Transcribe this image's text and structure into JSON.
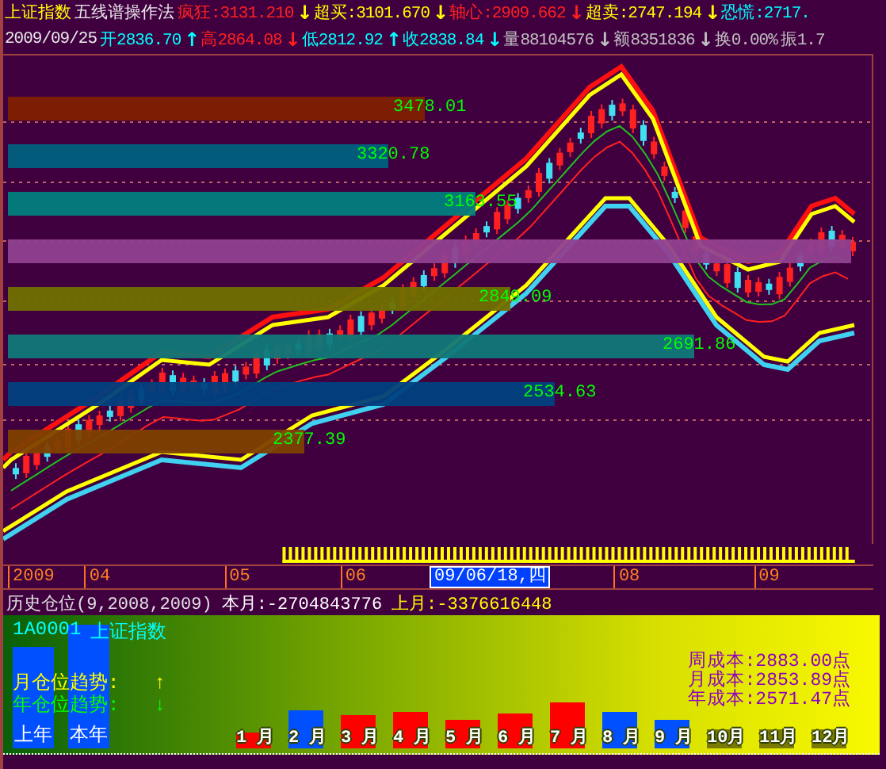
{
  "quote_lines": [
    [
      {
        "text": "上证指数",
        "color": "#ffff00"
      },
      {
        "text": "五线谱操作法",
        "color": "#e8e8e8"
      },
      {
        "text": "疯狂:3131.210",
        "color": "#ff2020",
        "arrow": {
          "text": "↓",
          "color": "#ffff00"
        }
      },
      {
        "text": "超买:3101.670",
        "color": "#ffff00",
        "arrow": {
          "text": "↓",
          "color": "#ffff00"
        }
      },
      {
        "text": "轴心:2909.662",
        "color": "#ff2020",
        "arrow": {
          "text": "↓",
          "color": "#ff2020"
        }
      },
      {
        "text": "超卖:2747.194",
        "color": "#ffff00",
        "arrow": {
          "text": "↓",
          "color": "#ffff00"
        }
      },
      {
        "text": "恐慌:2717.",
        "color": "#00ffff"
      }
    ],
    [
      {
        "text": "2009/09/25",
        "color": "#e8e8e8"
      },
      {
        "text": "开2836.70",
        "color": "#00ffff",
        "arrow": {
          "text": "↑",
          "color": "#00ffff"
        }
      },
      {
        "text": "高2864.08",
        "color": "#ff2020",
        "arrow": {
          "text": "↓",
          "color": "#ff2020"
        }
      },
      {
        "text": "低2812.92",
        "color": "#00ffff",
        "arrow": {
          "text": "↑",
          "color": "#00ffff"
        }
      },
      {
        "text": "收2838.84",
        "color": "#00ffff",
        "arrow": {
          "text": "↓",
          "color": "#00ffff"
        }
      },
      {
        "text": "量88104576",
        "color": "#c0c0c0",
        "arrow": {
          "text": "↓",
          "color": "#c0c0c0"
        }
      },
      {
        "text": "额8351836",
        "color": "#c0c0c0",
        "arrow": {
          "text": "↓",
          "color": "#c0c0c0"
        }
      },
      {
        "text": "换0.00%",
        "color": "#c0c0c0"
      },
      {
        "text": "振1.7",
        "color": "#c0c0c0"
      }
    ]
  ],
  "price_bands": [
    {
      "label": "3478.01",
      "color": "#802000"
    },
    {
      "label": "3320.78",
      "color": "#006080"
    },
    {
      "label": "3163.55",
      "color": "#008080"
    },
    {
      "color": "#904090"
    },
    {
      "label": "2849.09",
      "color": "#707000"
    },
    {
      "label": "2691.86",
      "color": "#107878"
    },
    {
      "label": "2534.63",
      "color": "#004080"
    },
    {
      "label": "2377.39",
      "color": "#804000"
    }
  ],
  "time_axis": [
    {
      "label": "2009",
      "selected": false
    },
    {
      "label": "04",
      "selected": false
    },
    {
      "label": "05",
      "selected": false
    },
    {
      "label": "06",
      "selected": false
    },
    {
      "label": "09/06/18,四",
      "selected": true
    },
    {
      "label": "08",
      "selected": false
    },
    {
      "label": "09",
      "selected": false
    }
  ],
  "info_line": {
    "title": "历史仓位(9,2008,2009)",
    "this_month": "本月:-2704843776",
    "last_month": "上月:-3376616448"
  },
  "position_panel": {
    "code": "1A0001",
    "name": "上证指数",
    "year_bars": [
      {
        "label": "上年"
      },
      {
        "label": "本年"
      }
    ],
    "trends": [
      {
        "label": "月仓位趋势:",
        "arrow": "↑",
        "color": "#ffff00"
      },
      {
        "label": "年仓位趋势:",
        "arrow": "↓",
        "color": "#00ff00"
      }
    ],
    "months": [
      {
        "label": "1 月",
        "color": "#ff0000"
      },
      {
        "label": "2 月",
        "color": "#0050ff"
      },
      {
        "label": "3 月",
        "color": "#ff0000"
      },
      {
        "label": "4 月",
        "color": "#ff0000"
      },
      {
        "label": "5 月",
        "color": "#ff0000"
      },
      {
        "label": "6 月",
        "color": "#ff0000"
      },
      {
        "label": "7 月",
        "color": "#ff0000"
      },
      {
        "label": "8 月",
        "color": "#0050ff"
      },
      {
        "label": "9 月",
        "color": "#0050ff"
      },
      {
        "label": "10月"
      },
      {
        "label": "11月"
      },
      {
        "label": "12月"
      }
    ],
    "costs": [
      "周成本:2883.00点",
      "月成本:2853.89点",
      "年成本:2571.47点"
    ]
  }
}
